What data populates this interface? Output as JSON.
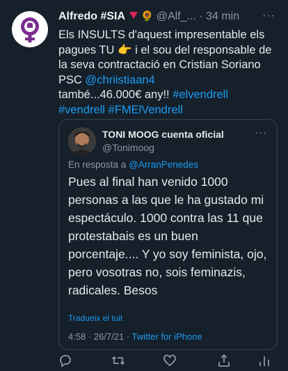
{
  "tweet": {
    "author_name": "Alfredo #SIA",
    "handle": "@Alf_...",
    "separator": "·",
    "time": "34 min",
    "more": "···",
    "text_parts": [
      "Els INSULTS d'aquest impresentable els pagues TU ",
      " i el sou del responsable de la seva contractació en Cristian Soriano PSC ",
      "@chriistiaan4",
      " també...46.000€ any!! ",
      "#elvendrell",
      "#vendrell",
      "#FMElVendrell"
    ]
  },
  "quote": {
    "author_name": "TONI MOOG cuenta oficial",
    "handle": "@Tonimoog",
    "more": "···",
    "reply_prefix": "En resposta a ",
    "reply_to": "@ArranPenedes",
    "text": "Pues al final han venido 1000 personas a las que le ha gustado mi espectáculo. 1000 contra las 11 que protestabais es un buen porcentaje.... Y yo soy feminista, ojo, pero vosotras no, sois feminazis, radicales. Besos",
    "translate": "Tradueix el tuit",
    "meta_prefix": "4:58 · 26/7/21 · ",
    "source": "Twitter for iPhone"
  },
  "icons": {
    "pointing": "👉",
    "sun": "🌻",
    "reply": "reply-icon",
    "retweet": "retweet-icon",
    "like": "like-icon",
    "share": "share-icon",
    "analytics": "analytics-icon"
  },
  "colors": {
    "background": "#15202b",
    "link": "#1d9bf0",
    "secondary": "#8b98a5",
    "feminist_purple": "#7b2d8e"
  }
}
